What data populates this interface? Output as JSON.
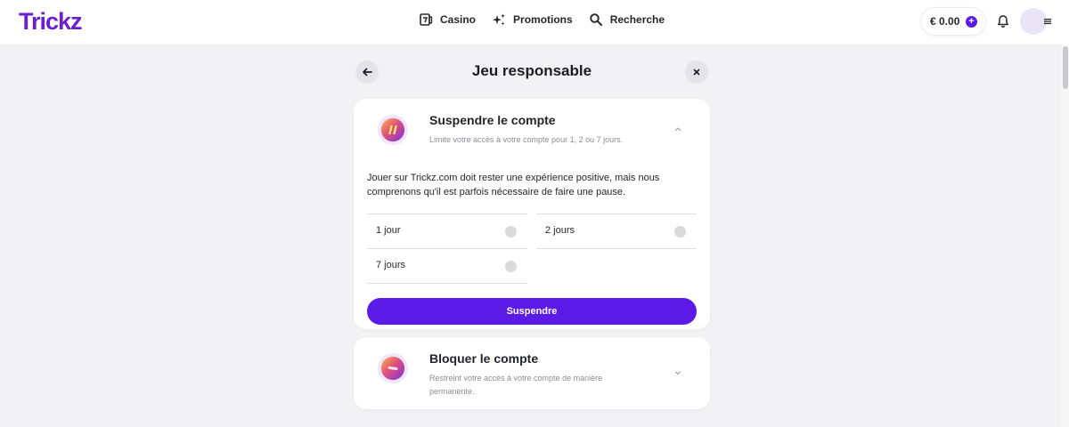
{
  "header": {
    "logo": "Trickz",
    "nav": [
      {
        "label": "Casino",
        "icon": "casino-icon"
      },
      {
        "label": "Promotions",
        "icon": "sparkle-icon"
      },
      {
        "label": "Recherche",
        "icon": "search-icon"
      }
    ],
    "balance": "€ 0.00"
  },
  "page": {
    "title": "Jeu responsable"
  },
  "suspend": {
    "title": "Suspendre le compte",
    "subtitle": "Limite votre accès à votre compte pour 1, 2 ou 7 jours.",
    "intro": "Jouer sur Trickz.com doit rester une expérience positive, mais nous comprenons qu'il est parfois nécessaire de faire une pause.",
    "options": [
      {
        "label": "1 jour"
      },
      {
        "label": "2 jours"
      },
      {
        "label": "7 jours"
      }
    ],
    "button": "Suspendre"
  },
  "block": {
    "title": "Bloquer le compte",
    "subtitle": "Restreint votre accès à votre compte de manière permanente."
  },
  "colors": {
    "brand": "#6b1fd1",
    "primary_button": "#5b1ae6",
    "page_bg": "#f2f2f4"
  }
}
